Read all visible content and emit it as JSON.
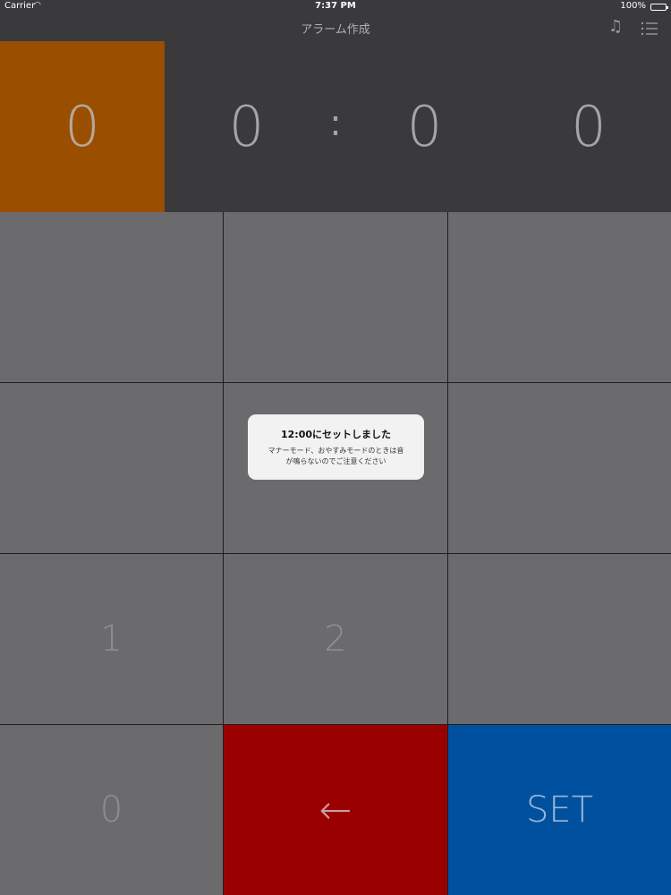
{
  "status_bar": {
    "carrier": "Carrier",
    "wifi_icon": "wifi-icon",
    "time": "7:37 PM",
    "battery": "100%"
  },
  "nav": {
    "title": "アラーム作成",
    "music_icon": "music-note-icon",
    "list_icon": "list-icon"
  },
  "display": {
    "digits": [
      "0",
      "0",
      "0",
      "0"
    ],
    "separator": ":",
    "active_digit_index": 0,
    "active_color": "#9a4e00"
  },
  "keypad": {
    "keys": [
      "",
      "",
      "",
      "",
      "",
      "",
      "1",
      "2",
      "",
      "0",
      "←",
      "SET"
    ],
    "back_color": "#9b0000",
    "set_color": "#0050a0"
  },
  "alert": {
    "title": "12:00にセットしました",
    "message_line1": "マナーモード、おやすみモードのときは音",
    "message_line2": "が鳴らないのでご注意ください"
  }
}
